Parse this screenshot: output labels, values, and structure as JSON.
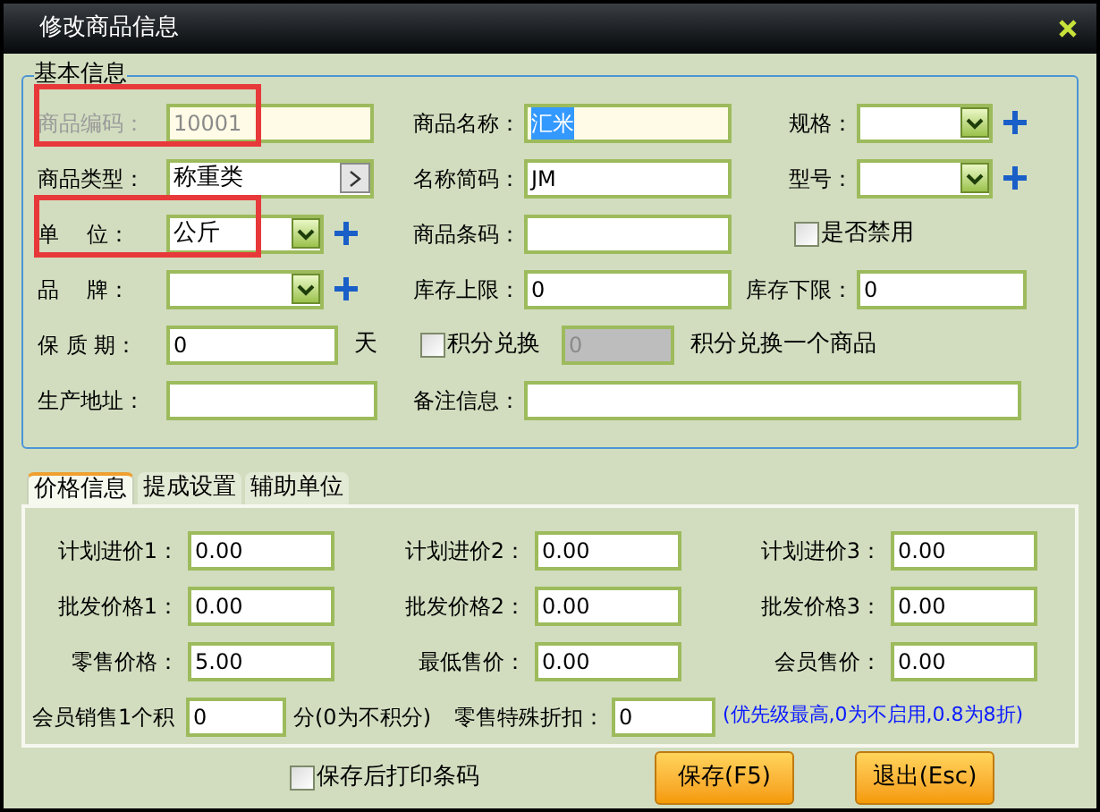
{
  "window": {
    "title": "修改商品信息"
  },
  "basic_info": {
    "title": "基本信息",
    "rows": [
      [
        {
          "kind": "text",
          "label": "商品编码：",
          "value": "10001",
          "disabled": true,
          "focused": false,
          "highlighted": true
        },
        {
          "kind": "text",
          "label": "商品名称：",
          "value": "汇米",
          "disabled": false,
          "focused": true
        },
        {
          "kind": "combo",
          "label": "规格：",
          "addable": true
        }
      ],
      [
        {
          "kind": "picker",
          "label": "商品类型：",
          "value": "称重类"
        },
        {
          "kind": "text",
          "label": "名称简码：",
          "value": "JM",
          "disabled": false,
          "focused": false
        },
        {
          "kind": "combo",
          "label": "型号：",
          "addable": true
        }
      ],
      [
        {
          "kind": "combo",
          "label": "单    位：",
          "value": "公斤",
          "addable": true,
          "highlighted": true
        },
        {
          "kind": "text",
          "label": "商品条码：",
          "disabled": false,
          "focused": false
        },
        {
          "kind": "checkbox",
          "label": "是否禁用",
          "checked": false
        }
      ],
      [
        {
          "kind": "combo",
          "label": "品    牌：",
          "addable": true
        },
        {
          "kind": "text",
          "label": "库存上限：",
          "value": "0",
          "disabled": false,
          "focused": false
        },
        {
          "kind": "text",
          "label": "库存下限：",
          "value": "0",
          "disabled": false,
          "focused": false
        }
      ],
      [
        {
          "kind": "text",
          "label": "保 质 期：",
          "value": "0",
          "suffix": "天",
          "disabled": false,
          "focused": false
        },
        {
          "kind": "checkbox",
          "label": "积分兑换",
          "checked": false
        },
        {
          "kind": "text",
          "value": "0",
          "suffix": "积分兑换一个商品",
          "disabled": true,
          "focused": false
        }
      ],
      [
        {
          "kind": "text",
          "label": "生产地址：",
          "disabled": false,
          "focused": false
        },
        {
          "kind": "text",
          "label": "备注信息：",
          "disabled": false,
          "focused": false
        }
      ]
    ]
  },
  "tabs": [
    {
      "label": "价格信息",
      "selected": true
    },
    {
      "label": "提成设置",
      "selected": false
    },
    {
      "label": "辅助单位",
      "selected": false
    }
  ],
  "prices": [
    [
      {
        "label": "计划进价1：",
        "value": "0.00"
      },
      {
        "label": "计划进价2：",
        "value": "0.00"
      },
      {
        "label": "计划进价3：",
        "value": "0.00"
      }
    ],
    [
      {
        "label": "批发价格1：",
        "value": "0.00"
      },
      {
        "label": "批发价格2：",
        "value": "0.00"
      },
      {
        "label": "批发价格3：",
        "value": "0.00"
      }
    ],
    [
      {
        "label": "零售价格：",
        "value": "5.00"
      },
      {
        "label": "最低售价：",
        "value": "0.00"
      },
      {
        "label": "会员售价：",
        "value": "0.00"
      }
    ]
  ],
  "member_points": {
    "label": "会员销售1个积",
    "value": "0",
    "suffix": "分(0为不积分)"
  },
  "special_discount": {
    "label": "零售特殊折扣：",
    "value": "0",
    "note": "(优先级最高,0为不启用,0.8为8折)"
  },
  "print_option": {
    "label": "保存后打印条码",
    "checked": false
  },
  "buttons": [
    {
      "label": "保存(F5)"
    },
    {
      "label": "退出(Esc)"
    }
  ]
}
